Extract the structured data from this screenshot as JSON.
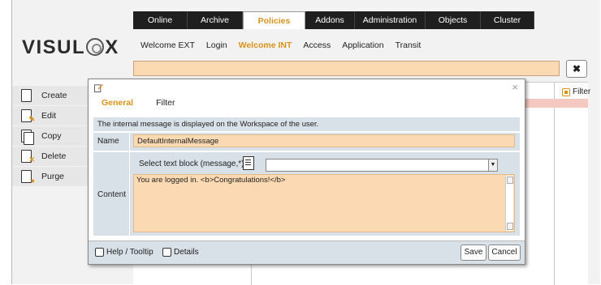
{
  "topnav": {
    "tabs": [
      "Online",
      "Archive",
      "Policies",
      "Addons",
      "Administration",
      "Objects",
      "Cluster"
    ],
    "active": "Policies"
  },
  "logo": {
    "left": "VISUL",
    "right": "X"
  },
  "subnav": {
    "items": [
      "Welcome EXT",
      "Login",
      "Welcome INT",
      "Access",
      "Application",
      "Transit"
    ],
    "active": "Welcome INT"
  },
  "close_button": {
    "label": "✖"
  },
  "sidebar": {
    "items": [
      {
        "label": "Create",
        "icon": "new-document-icon"
      },
      {
        "label": "Edit",
        "icon": "edit-document-icon"
      },
      {
        "label": "Copy",
        "icon": "copy-document-icon"
      },
      {
        "label": "Delete",
        "icon": "delete-document-icon"
      },
      {
        "label": "Purge",
        "icon": "purge-document-icon"
      }
    ]
  },
  "filter": {
    "label": "Filter"
  },
  "dialog": {
    "close": "×",
    "tabs": [
      "General",
      "Filter"
    ],
    "active_tab": "General",
    "info": "The internal message is displayed on the Workspace of the user.",
    "name_label": "Name",
    "name_value": "DefaultInternalMessage",
    "content_label": "Content",
    "select_label": "Select text block (message,*)",
    "select_value": "",
    "content_value": "You are logged in. <b>Congratulations!</b>",
    "help_label": "Help / Tooltip",
    "details_label": "Details",
    "save_label": "Save",
    "cancel_label": "Cancel"
  },
  "colors": {
    "accent": "#d9921b",
    "field_bg": "#fbd9b2",
    "panel_bg": "#d8e0e8",
    "nav_bg": "#1f1f1f"
  }
}
